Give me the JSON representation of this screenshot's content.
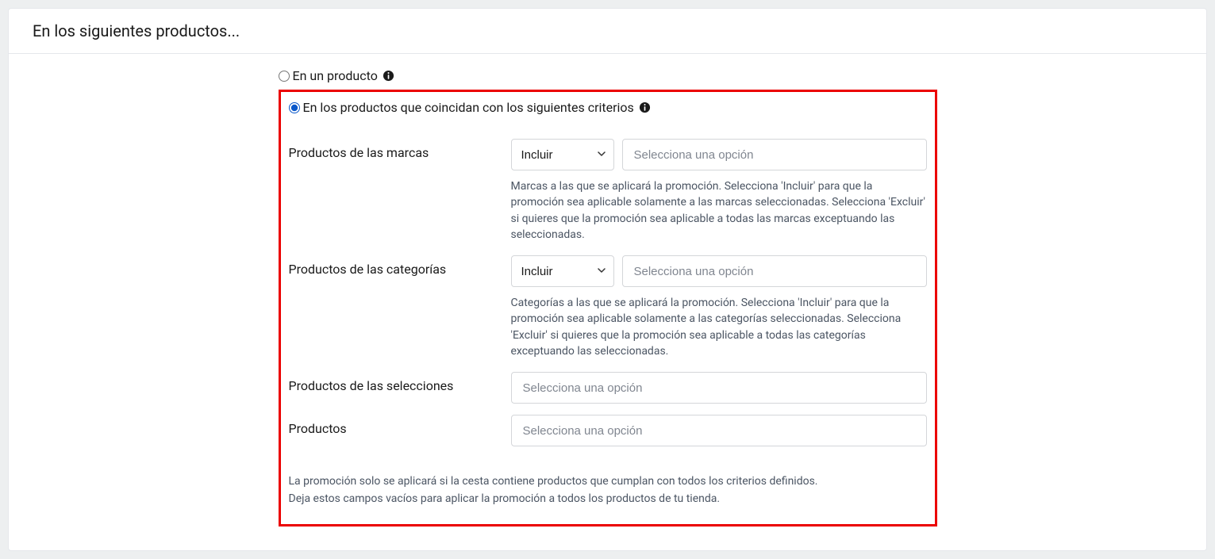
{
  "header": {
    "title": "En los siguientes productos..."
  },
  "radios": {
    "single": {
      "label": "En un producto"
    },
    "criteria": {
      "label": "En los productos que coincidan con los siguientes criterios"
    }
  },
  "fields": {
    "brands": {
      "label": "Productos de las marcas",
      "include_value": "Incluir",
      "placeholder": "Selecciona una opción",
      "help": "Marcas a las que se aplicará la promoción. Selecciona 'Incluir' para que la promoción sea aplicable solamente a las marcas seleccionadas. Selecciona 'Excluir' si quieres que la promoción sea aplicable a todas las marcas exceptuando las seleccionadas."
    },
    "categories": {
      "label": "Productos de las categorías",
      "include_value": "Incluir",
      "placeholder": "Selecciona una opción",
      "help": "Categorías a las que se aplicará la promoción. Selecciona 'Incluir' para que la promoción sea aplicable solamente a las categorías seleccionadas. Selecciona 'Excluir' si quieres que la promoción sea aplicable a todas las categorías exceptuando las seleccionadas."
    },
    "selections": {
      "label": "Productos de las selecciones",
      "placeholder": "Selecciona una opción"
    },
    "products": {
      "label": "Productos",
      "placeholder": "Selecciona una opción"
    }
  },
  "footer": {
    "line1": "La promoción solo se aplicará si la cesta contiene productos que cumplan con todos los criterios definidos.",
    "line2": "Deja estos campos vacíos para aplicar la promoción a todos los productos de tu tienda."
  }
}
